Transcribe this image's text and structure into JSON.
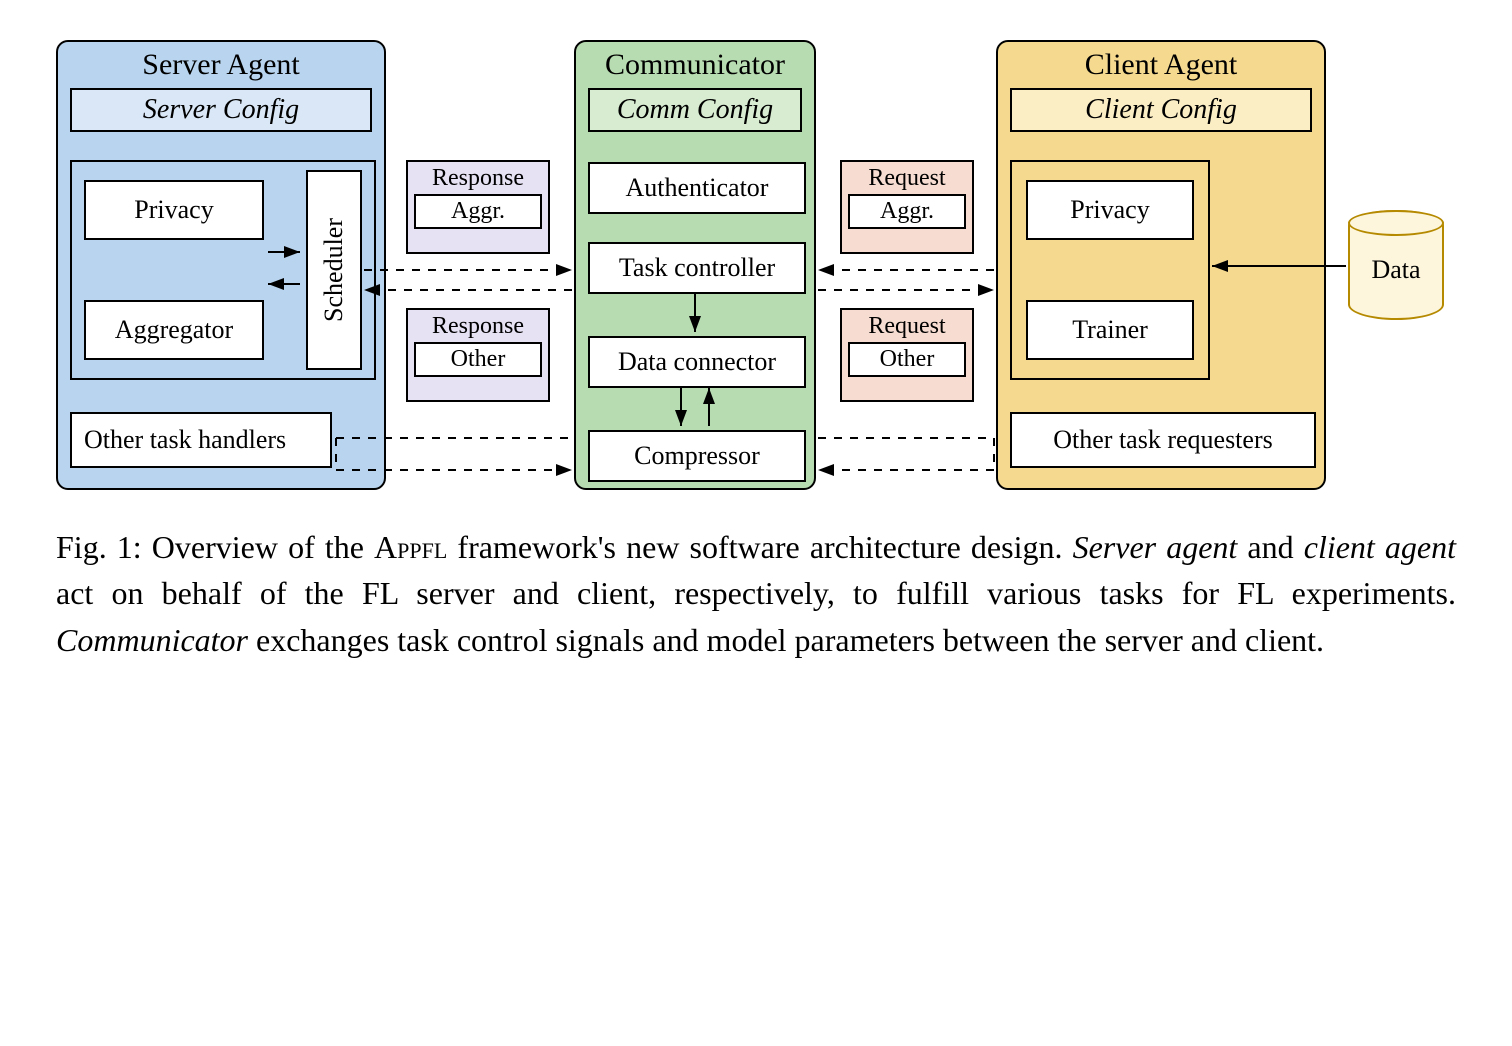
{
  "server": {
    "title": "Server Agent",
    "config": "Server Config",
    "privacy": "Privacy",
    "aggregator": "Aggregator",
    "scheduler": "Scheduler",
    "other_handlers": "Other task handlers"
  },
  "communicator": {
    "title": "Communicator",
    "config": "Comm Config",
    "authenticator": "Authenticator",
    "task_controller": "Task controller",
    "data_connector": "Data connector",
    "compressor": "Compressor"
  },
  "client": {
    "title": "Client Agent",
    "config": "Client Config",
    "privacy": "Privacy",
    "trainer": "Trainer",
    "other_requesters": "Other task requesters",
    "data": "Data"
  },
  "messages": {
    "response_label": "Response",
    "request_label": "Request",
    "aggr": "Aggr.",
    "other": "Other"
  },
  "caption": {
    "prefix": "Fig. 1: Overview of the ",
    "smallcaps": "Appfl",
    "rest": " framework's new software architecture design. Server agent and client agent act on behalf of the FL server and client, respectively, to fulfill various tasks for FL experiments. Communicator exchanges task control signals and model parameters between the server and client."
  },
  "colors": {
    "server_bg": "#b8d4ee",
    "server_cfg": "#d9e7f6",
    "comm_bg": "#b8dcb1",
    "comm_cfg": "#d7ecd1",
    "client_bg": "#f4d98f",
    "client_cfg": "#fbeec4",
    "resp_bg": "#e6e1f3",
    "req_bg": "#f6dcd1"
  }
}
